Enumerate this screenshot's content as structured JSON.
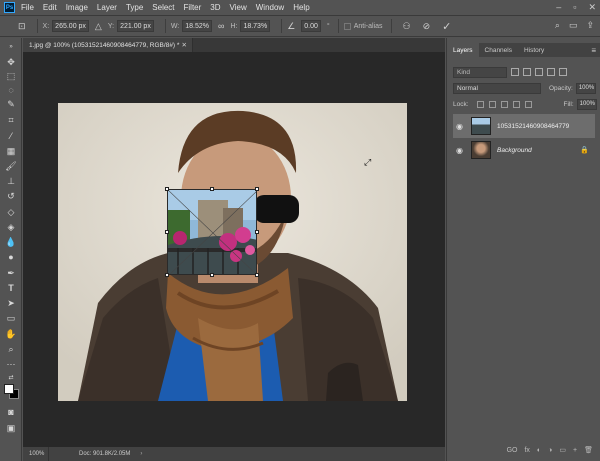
{
  "menu": {
    "logo": "Ps",
    "items": [
      "File",
      "Edit",
      "Image",
      "Layer",
      "Type",
      "Select",
      "Filter",
      "3D",
      "View",
      "Window",
      "Help"
    ]
  },
  "options": {
    "x_label": "X:",
    "x_value": "265.00 px",
    "y_label": "Y:",
    "y_value": "221.00 px",
    "w_label": "W:",
    "w_value": "18.52%",
    "h_label": "H:",
    "h_value": "18.73%",
    "angle_value": "0.00",
    "angle_unit": "°",
    "antialias_label": "Anti-alias",
    "cancel_icon": "⃠",
    "commit_icon": "✓"
  },
  "document": {
    "tab_title": "1.jpg @ 100% (10531521460908464779, RGB/8#) *",
    "zoom": "100%",
    "doc_info": "Doc: 901.8K/2.05M"
  },
  "layers_panel": {
    "tabs": [
      "Layers",
      "Channels",
      "History"
    ],
    "kind_label": "Kind",
    "blend_mode": "Normal",
    "opacity_label": "Opacity:",
    "opacity_value": "100%",
    "lock_label": "Lock:",
    "fill_label": "Fill:",
    "fill_value": "100%",
    "layers": [
      {
        "name": "10531521460908464779",
        "selected": true
      },
      {
        "name": "Background",
        "selected": false
      }
    ],
    "bottom_icons": [
      "GO",
      "fx",
      "◐",
      "◑",
      "▭",
      "+",
      "🗑"
    ]
  },
  "colors": {
    "ui_bg": "#535353",
    "panel_dark": "#424242",
    "canvas_bg": "#282828",
    "photo_bg": "#e2ddd1",
    "selected_layer": "#6d6d6d"
  }
}
